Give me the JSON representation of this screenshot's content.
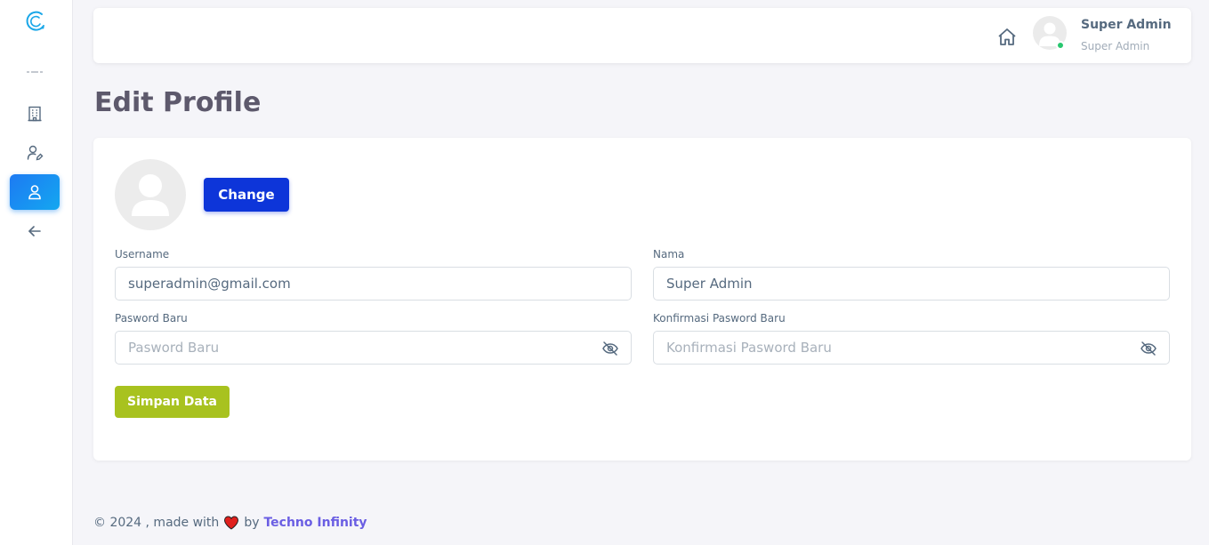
{
  "header": {
    "user_name": "Super Admin",
    "user_role": "Super Admin"
  },
  "sidebar": {
    "items": [
      {
        "icon": "building-icon"
      },
      {
        "icon": "user-edit-icon"
      },
      {
        "icon": "user-icon",
        "active": true
      },
      {
        "icon": "arrow-left-icon"
      }
    ]
  },
  "page": {
    "title": "Edit Profile"
  },
  "form": {
    "change_label": "Change",
    "username_label": "Username",
    "username_value": "superadmin@gmail.com",
    "nama_label": "Nama",
    "nama_value": "Super Admin",
    "password_label": "Pasword Baru",
    "password_placeholder": "Pasword Baru",
    "confirm_label": "Konfirmasi Pasword Baru",
    "confirm_placeholder": "Konfirmasi Pasword Baru",
    "save_label": "Simpan Data"
  },
  "footer": {
    "prefix": "© 2024 , made with",
    "by": "by",
    "company": "Techno Infinity"
  },
  "colors": {
    "primary": "#0d35d9",
    "save": "#a8c21f",
    "active_nav": "#1d7af3",
    "online": "#28c76f",
    "link": "#6a5ee3"
  }
}
